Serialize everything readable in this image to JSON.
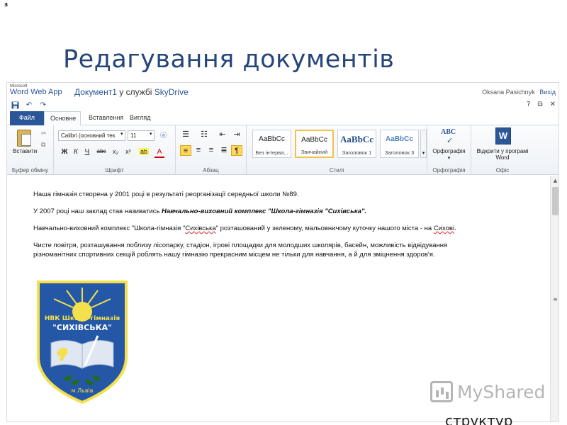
{
  "slide": {
    "marker": "з",
    "title": "Редагування документів"
  },
  "header": {
    "brand_small": "Microsoft",
    "brand": "Word Web App",
    "doc_name": "Документ1",
    "in_service": "у службі",
    "service": "SkyDrive",
    "user": "Oksana Pasichnyk",
    "signout": "Вихід"
  },
  "quick_access": [
    "save-icon",
    "undo-icon",
    "redo-icon"
  ],
  "window_controls": [
    "?",
    "⧉",
    "✕"
  ],
  "tabs": {
    "file": "Файл",
    "home": "Основне",
    "insert": "Вставлення",
    "view": "Вигляд"
  },
  "ribbon": {
    "clipboard": {
      "paste": "Вставити",
      "label": "Буфер обміну"
    },
    "font": {
      "name": "Calibri (основний тек",
      "size": "11",
      "bold": "Ж",
      "italic": "К",
      "underline": "Ч",
      "strike": "abc",
      "subscript": "x₂",
      "superscript": "x²",
      "label": "Шрифт"
    },
    "paragraph": {
      "label": "Абзац"
    },
    "styles": {
      "items": [
        {
          "sample": "AaBbCc",
          "name": "Без інтерва..."
        },
        {
          "sample": "AaBbCc",
          "name": "Звичайний"
        },
        {
          "sample": "AaBbCc",
          "name": "Заголовок 1"
        },
        {
          "sample": "AaBbCc",
          "name": "Заголовок 3"
        }
      ],
      "label": "Стилі"
    },
    "spelling": {
      "icon_text": "ABC",
      "button": "Орфографія",
      "label": "Орфографія"
    },
    "office": {
      "icon_text": "W",
      "button": "Відкрити у програмі Word",
      "label": "Офіс"
    }
  },
  "document": {
    "p1": "Наша гімназія створена у 2001 році в результаті реорганізації середньої школи №89.",
    "p2_prefix": "У 2007 році наш заклад став називатись ",
    "p2_bold": "Навчально-виховний комплекс \"Школа-гімназія \"Сихівська\".",
    "p3_prefix": "Навчально-виховний комплекс \"Школа-гімназія \"",
    "p3_word": "Сихівська",
    "p3_mid": "\" розташований у зеленому, мальовничому куточку нашого міста - на ",
    "p3_word2": "Сихові",
    "p3_end": ".",
    "p4_line1": "Чисте повітря, розташування поблизу лісопарку, стадіон, ігрові площадки для молодших школярів, басейн, можливість відвідування",
    "p4_line2": "різноманітних спортивних секцій роблять нашу гімназію прекрасним місцем не тільки для навчання, а й для зміцнення здоров'я."
  },
  "emblem": {
    "line1": "НВК Школа-гімназія",
    "line2": "\"СИХІВСЬКА\"",
    "city": "м.Львів"
  },
  "watermark": "MyShared",
  "cut_text": "структур",
  "colors": {
    "title": "#26467a",
    "accent": "#2b579a",
    "emblem_blue": "#2457a6",
    "emblem_yellow": "#f4e04d"
  }
}
